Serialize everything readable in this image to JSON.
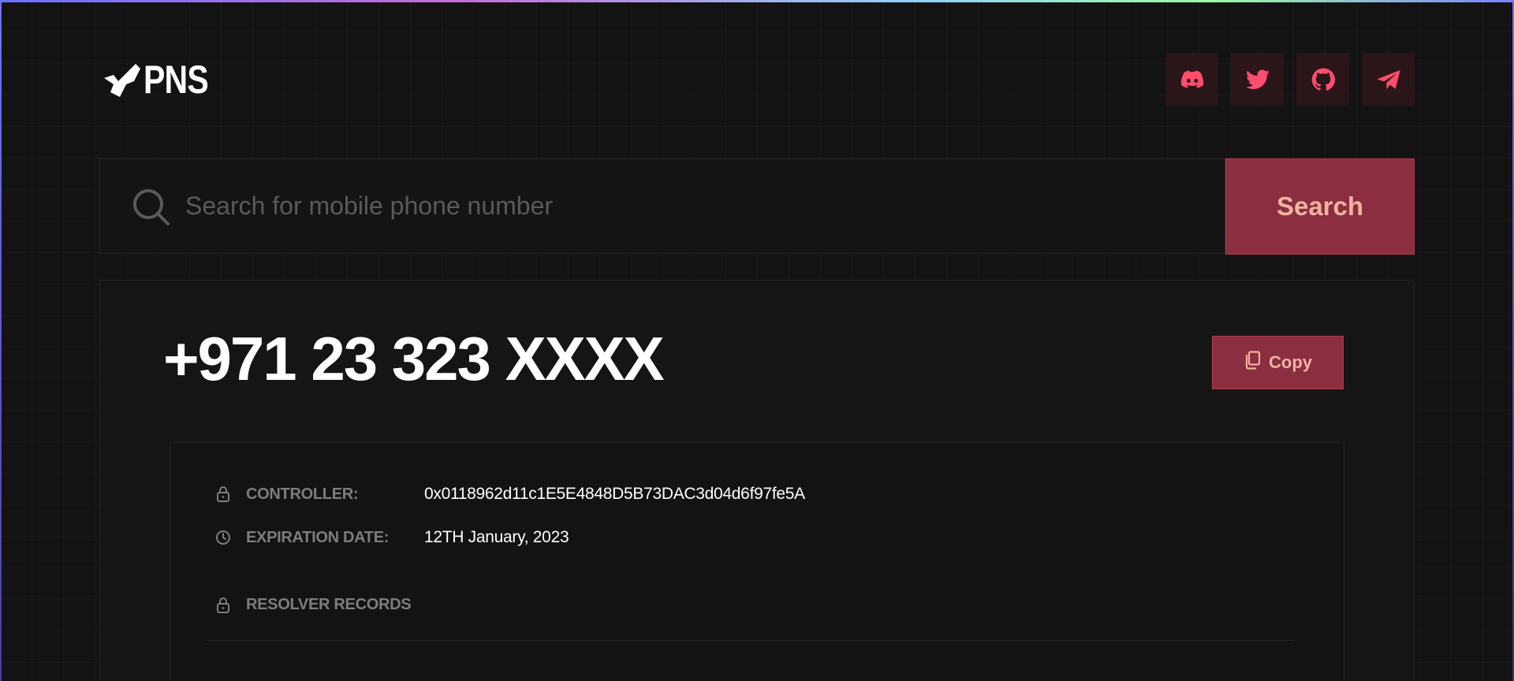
{
  "header": {
    "logo_text": "PNS",
    "socials": [
      {
        "name": "discord",
        "icon": "discord-icon"
      },
      {
        "name": "twitter",
        "icon": "twitter-icon"
      },
      {
        "name": "github",
        "icon": "github-icon"
      },
      {
        "name": "telegram",
        "icon": "telegram-icon"
      }
    ]
  },
  "search": {
    "placeholder": "Search for mobile phone number",
    "value": "",
    "button_label": "Search"
  },
  "result": {
    "phone_number": "+971 23 323 XXXX",
    "copy_label": "Copy",
    "details": {
      "controller_label": "CONTROLLER:",
      "controller_value": "0x0118962d11c1E5E4848D5B73DAC3d04d6f97fe5A",
      "expiration_label": "EXPIRATION DATE:",
      "expiration_value": "12TH January, 2023",
      "resolver_label": "RESOLVER RECORDS"
    }
  },
  "colors": {
    "background": "#131313",
    "accent": "#8a2e40",
    "accent_text": "#f2b2a0",
    "social_icon": "#ff4d6d",
    "social_bg": "#2a1519"
  }
}
